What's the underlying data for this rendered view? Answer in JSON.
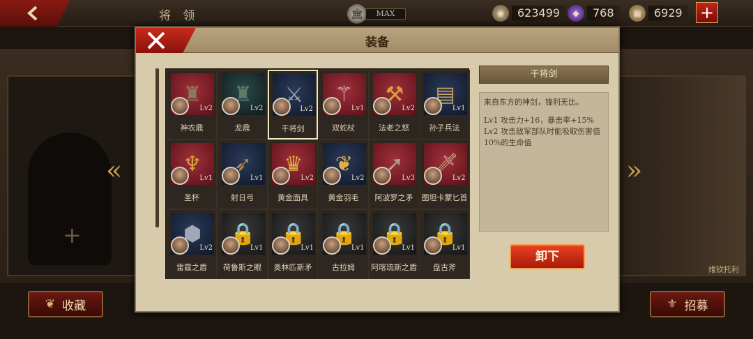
{
  "topbar": {
    "title": "将 领",
    "max_label": "MAX",
    "coins": "623499",
    "gems": "768",
    "materials": "6929",
    "add_icon": "plus-icon"
  },
  "side": {
    "hero_name": "维钦托利"
  },
  "bottom": {
    "collect_label": "收藏",
    "recruit_label": "招募"
  },
  "modal": {
    "title": "装备",
    "items": [
      {
        "name": "神农鼎",
        "lv": "Lv2",
        "bg": "red",
        "art": "♜",
        "art_color": "#8a7a5a"
      },
      {
        "name": "龙鼎",
        "lv": "Lv2",
        "bg": "teal",
        "art": "♜",
        "art_color": "#5a7a6a"
      },
      {
        "name": "干将剑",
        "lv": "Lv2",
        "bg": "navy",
        "art": "⚔",
        "art_color": "#9aa8b0",
        "selected": true
      },
      {
        "name": "双蛇杖",
        "lv": "Lv1",
        "bg": "red",
        "art": "⚚",
        "art_color": "#c8c8c8"
      },
      {
        "name": "法老之怒",
        "lv": "Lv2",
        "bg": "red",
        "art": "⚒",
        "art_color": "#d8a040"
      },
      {
        "name": "孙子兵法",
        "lv": "Lv1",
        "bg": "navy",
        "art": "▤",
        "art_color": "#c8a060"
      },
      {
        "name": "圣杯",
        "lv": "Lv1",
        "bg": "red",
        "art": "♆",
        "art_color": "#d8a040"
      },
      {
        "name": "射日弓",
        "lv": "Lv1",
        "bg": "navy",
        "art": "➶",
        "art_color": "#b88a50"
      },
      {
        "name": "黄金面具",
        "lv": "Lv2",
        "bg": "red",
        "art": "♛",
        "art_color": "#e0b040"
      },
      {
        "name": "黄金羽毛",
        "lv": "Lv2",
        "bg": "navy",
        "art": "❦",
        "art_color": "#e0b040"
      },
      {
        "name": "阿波罗之矛",
        "lv": "Lv3",
        "bg": "red",
        "art": "➚",
        "art_color": "#b0a090"
      },
      {
        "name": "图坦卡蒙匕首",
        "lv": "Lv2",
        "bg": "red",
        "art": "🗡",
        "art_color": "#c8b090"
      },
      {
        "name": "雷霆之盾",
        "lv": "Lv2",
        "bg": "navy",
        "art": "⬢",
        "art_color": "#a0a8b8"
      },
      {
        "name": "荷鲁斯之眼",
        "lv": "Lv1",
        "bg": "dark",
        "art": "🔒",
        "art_color": "#e0c060"
      },
      {
        "name": "奥林匹斯矛",
        "lv": "Lv1",
        "bg": "dark",
        "art": "🔒",
        "art_color": "#e0c060"
      },
      {
        "name": "古拉姆",
        "lv": "Lv1",
        "bg": "dark",
        "art": "🔒",
        "art_color": "#e0c060"
      },
      {
        "name": "阿喀琉斯之盾",
        "lv": "Lv1",
        "bg": "dark",
        "art": "🔒",
        "art_color": "#e0c060"
      },
      {
        "name": "盘古斧",
        "lv": "Lv1",
        "bg": "dark",
        "art": "🔒",
        "art_color": "#e0c060"
      }
    ],
    "detail": {
      "title": "干将剑",
      "desc": "来自东方的神剑，锋利无比。",
      "lv1": "Lv1  攻击力+16，暴击率+15%",
      "lv2": "Lv2  攻击敌军部队时能吸取伤害值10%的生命值"
    },
    "unequip_label": "卸下"
  }
}
